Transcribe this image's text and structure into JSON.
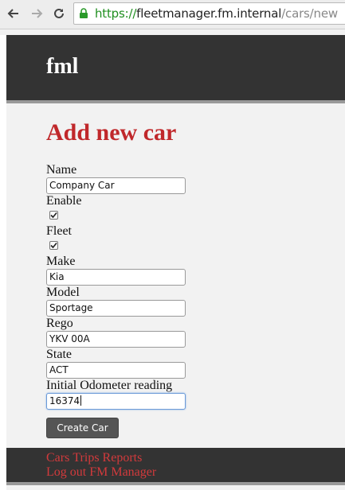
{
  "browser": {
    "url_scheme": "https://",
    "url_host": "fleetmanager.fm.internal",
    "url_path": "/cars/new"
  },
  "header": {
    "brand": "fml"
  },
  "page": {
    "title": "Add new car"
  },
  "form": {
    "name_label": "Name",
    "name_value": "Company Car",
    "enable_label": "Enable",
    "enable_checked": true,
    "fleet_label": "Fleet",
    "fleet_checked": true,
    "make_label": "Make",
    "make_value": "Kia",
    "model_label": "Model",
    "model_value": "Sportage",
    "rego_label": "Rego",
    "rego_value": "YKV 00A",
    "state_label": "State",
    "state_value": "ACT",
    "odometer_label": "Initial Odometer reading",
    "odometer_value": "16374",
    "submit_label": "Create Car"
  },
  "footer": {
    "cars_link": "Cars",
    "trips_link": "Trips",
    "reports_link": "Reports",
    "logout_link": "Log out",
    "manager_link": "FM Manager"
  },
  "colors": {
    "accent": "#c0282b",
    "link": "#d23a3c",
    "header_bg": "#333333"
  }
}
